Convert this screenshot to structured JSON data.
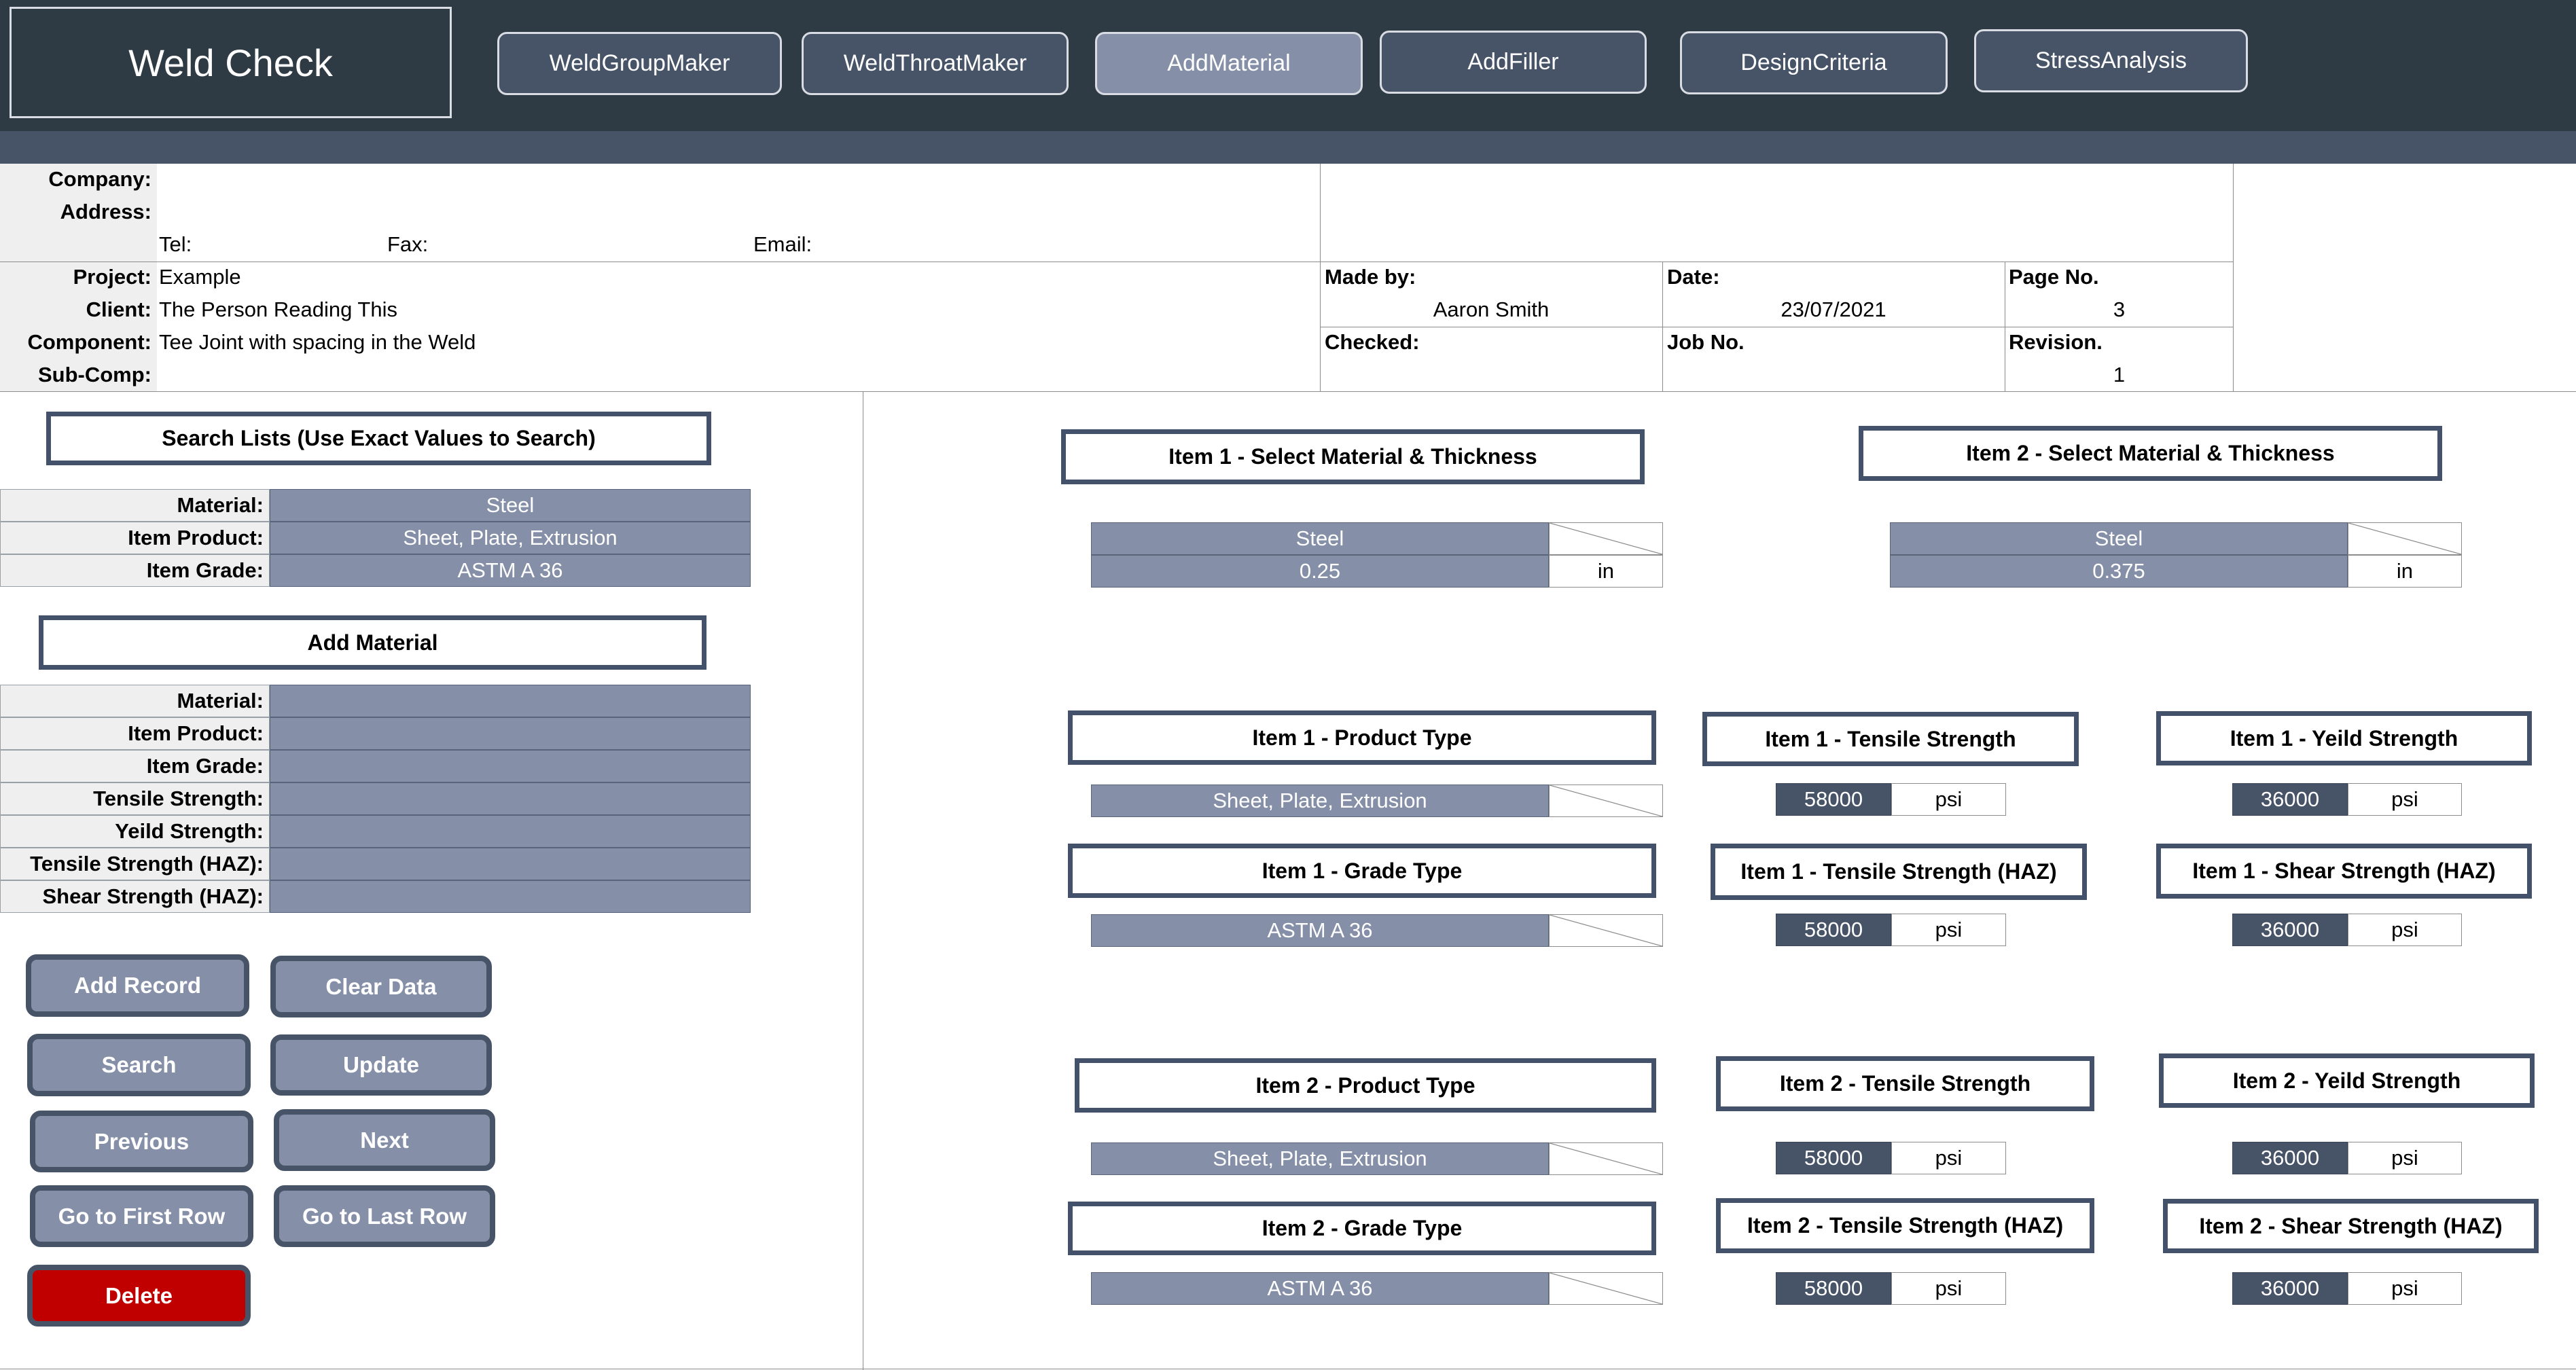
{
  "app": {
    "title": "Weld Check",
    "nav": [
      "WeldGroupMaker",
      "WeldThroatMaker",
      "AddMaterial",
      "AddFiller",
      "DesignCriteria",
      "StressAnalysis"
    ],
    "active_nav": "AddMaterial"
  },
  "header": {
    "company_label": "Company:",
    "address_label": "Address:",
    "tel_label": "Tel:",
    "fax_label": "Fax:",
    "email_label": "Email:",
    "project_label": "Project:",
    "project": "Example",
    "client_label": "Client:",
    "client": "The Person Reading This",
    "component_label": "Component:",
    "component": "Tee Joint with spacing in the Weld",
    "subcomp_label": "Sub-Comp:",
    "made_by_label": "Made by:",
    "made_by": "Aaron Smith",
    "date_label": "Date:",
    "date": "23/07/2021",
    "page_label": "Page No.",
    "page": "3",
    "checked_label": "Checked:",
    "job_label": "Job No.",
    "revision_label": "Revision.",
    "revision": "1"
  },
  "search": {
    "title": "Search Lists (Use Exact Values to Search)",
    "rows": [
      {
        "label": "Material:",
        "value": "Steel"
      },
      {
        "label": "Item Product:",
        "value": "Sheet, Plate, Extrusion"
      },
      {
        "label": "Item Grade:",
        "value": "ASTM A 36"
      }
    ]
  },
  "add": {
    "title": "Add Material",
    "rows": [
      {
        "label": "Material:",
        "value": ""
      },
      {
        "label": "Item Product:",
        "value": ""
      },
      {
        "label": "Item Grade:",
        "value": ""
      },
      {
        "label": "Tensile Strength:",
        "value": ""
      },
      {
        "label": "Yeild Strength:",
        "value": ""
      },
      {
        "label": "Tensile Strength (HAZ):",
        "value": ""
      },
      {
        "label": "Shear Strength (HAZ):",
        "value": ""
      }
    ]
  },
  "buttons": {
    "add_record": "Add Record",
    "clear_data": "Clear Data",
    "search": "Search",
    "update": "Update",
    "previous": "Previous",
    "next": "Next",
    "first_row": "Go to First Row",
    "last_row": "Go to Last Row",
    "delete": "Delete"
  },
  "item1": {
    "select_title": "Item 1 - Select Material & Thickness",
    "material": "Steel",
    "thickness": "0.25",
    "thickness_unit": "in",
    "product_title": "Item 1 - Product Type",
    "product": "Sheet, Plate, Extrusion",
    "grade_title": "Item 1 - Grade Type",
    "grade": "ASTM A 36",
    "tensile_title": "Item 1 - Tensile Strength",
    "tensile": "58000",
    "yield_title": "Item 1 - Yeild Strength",
    "yield": "36000",
    "tensile_haz_title": "Item 1 - Tensile Strength (HAZ)",
    "tensile_haz": "58000",
    "shear_haz_title": "Item 1 - Shear Strength (HAZ)",
    "shear_haz": "36000",
    "unit": "psi"
  },
  "item2": {
    "select_title": "Item 2 - Select Material & Thickness",
    "material": "Steel",
    "thickness": "0.375",
    "thickness_unit": "in",
    "product_title": "Item 2 - Product Type",
    "product": "Sheet, Plate, Extrusion",
    "grade_title": "Item 2 - Grade Type",
    "grade": "ASTM A 36",
    "tensile_title": "Item 2 - Tensile Strength",
    "tensile": "58000",
    "yield_title": "Item 2 - Yeild Strength",
    "yield": "36000",
    "tensile_haz_title": "Item 2 - Tensile Strength (HAZ)",
    "tensile_haz": "58000",
    "shear_haz_title": "Item 2 - Shear Strength (HAZ)",
    "shear_haz": "36000",
    "unit": "psi"
  },
  "colors": {
    "topbar": "#2e3b44",
    "subbar": "#475468",
    "input_fill": "#8590a8",
    "value_fill": "#475468",
    "danger": "#c00000"
  }
}
